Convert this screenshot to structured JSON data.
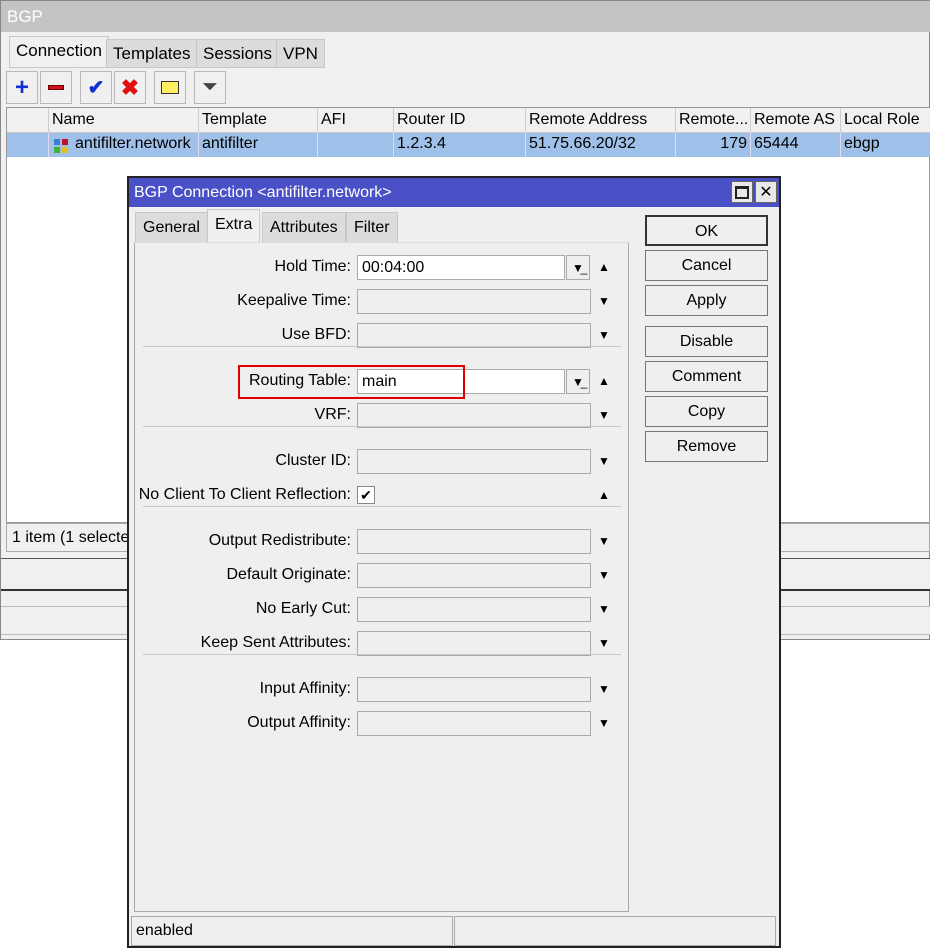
{
  "main": {
    "title": "BGP",
    "tabs": [
      "Connection",
      "Templates",
      "Sessions",
      "VPN"
    ],
    "columns": [
      "Name",
      "Template",
      "AFI",
      "Router ID",
      "Remote Address",
      "Remote...",
      "Remote AS",
      "Local Role"
    ],
    "rows": [
      [
        "antifilter.network",
        "antifilter",
        "",
        "1.2.3.4",
        "51.75.66.20/32",
        "179",
        "65444",
        "ebgp"
      ]
    ],
    "status": "1 item (1 selected)"
  },
  "dialog": {
    "title": "BGP Connection <antifilter.network>",
    "tabs": [
      "General",
      "Extra",
      "Attributes",
      "Filter"
    ],
    "fields": [
      {
        "label": "Hold Time:",
        "value": "00:04:00",
        "dropdown": true,
        "arrow": "up"
      },
      {
        "label": "Keepalive Time:",
        "value": "",
        "arrow": "down"
      },
      {
        "label": "Use BFD:",
        "value": "",
        "arrow": "down",
        "sep": true
      },
      {
        "label": "Routing Table:",
        "value": "main",
        "dropdown": true,
        "arrow": "up",
        "highlight": true
      },
      {
        "label": "VRF:",
        "value": "",
        "arrow": "down",
        "sep": true
      },
      {
        "label": "Cluster ID:",
        "value": "",
        "arrow": "down"
      },
      {
        "label": "No Client To Client Reflection:",
        "checkbox": true,
        "checked": true,
        "arrow": "up",
        "sep": true
      },
      {
        "label": "Output Redistribute:",
        "value": "",
        "arrow": "down"
      },
      {
        "label": "Default Originate:",
        "value": "",
        "arrow": "down"
      },
      {
        "label": "No Early Cut:",
        "value": "",
        "arrow": "down"
      },
      {
        "label": "Keep Sent Attributes:",
        "value": "",
        "arrow": "down",
        "sep": true
      },
      {
        "label": "Input Affinity:",
        "value": "",
        "arrow": "down"
      },
      {
        "label": "Output Affinity:",
        "value": "",
        "arrow": "down"
      }
    ],
    "buttons": [
      "OK",
      "Cancel",
      "Apply",
      "Disable",
      "Comment",
      "Copy",
      "Remove"
    ],
    "status": "enabled"
  },
  "colors": {
    "title_bar": "#4a50c6",
    "selection": "#9fc0e8",
    "highlight": "#e00000"
  }
}
